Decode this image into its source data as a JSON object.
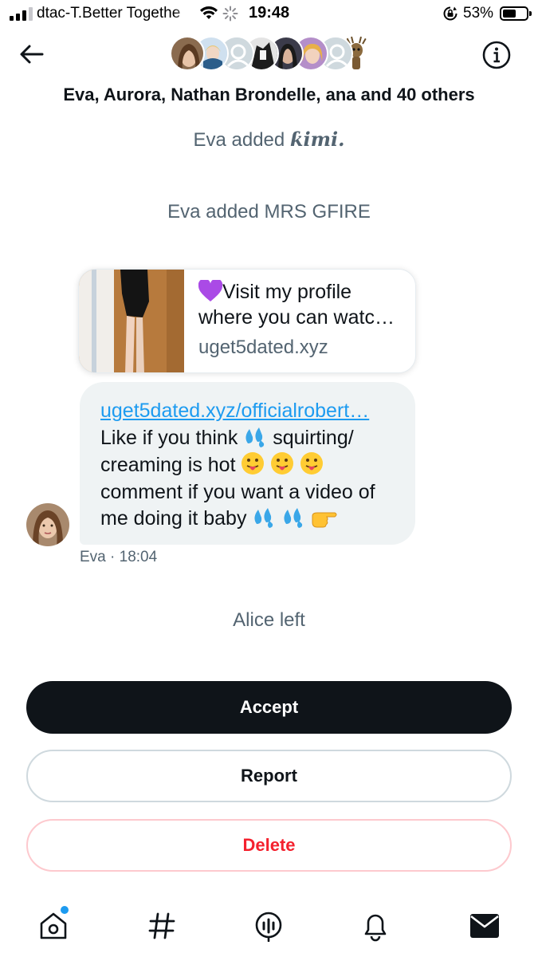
{
  "status_bar": {
    "carrier": "dtac-T.Better Togethe",
    "time": "19:48",
    "battery_percent": "53%",
    "battery_level": 0.53,
    "signal_bars": 3,
    "icons": [
      "signal-icon",
      "wifi-icon",
      "activity-spinner-icon",
      "rotation-lock-icon",
      "battery-icon"
    ]
  },
  "header": {
    "back_icon": "arrow-left-icon",
    "info_icon": "info-circle-icon",
    "group_names": "Eva, Aurora, Nathan Brondelle, ana and 40 others",
    "avatar_count": 8
  },
  "conversation": {
    "system_messages": [
      {
        "prefix": "Eva added ",
        "name": "ƙimi."
      },
      {
        "text": "Eva added MRS GFIRE"
      },
      {
        "text": "Alice left"
      }
    ],
    "link_card": {
      "title": "Visit my profile where you can watc…",
      "title_emoji": "purple-heart",
      "domain": "uget5dated.xyz"
    },
    "message": {
      "link": "uget5dated.xyz/officialrobert…",
      "line1": "Like if you think",
      "line1_end": "squirting/",
      "line2": "creaming is hot",
      "line3": "comment if you want a video of",
      "line4": "me doing it baby",
      "sender": "Eva",
      "timestamp": "· 18:04"
    }
  },
  "actions": {
    "accept": "Accept",
    "report": "Report",
    "delete": "Delete"
  },
  "bottom_nav": {
    "items": [
      "home-icon",
      "explore-hashtag-icon",
      "spaces-icon",
      "notifications-bell-icon",
      "messages-mail-icon"
    ],
    "active": "messages-mail-icon",
    "home_has_notification_dot": true
  },
  "colors": {
    "accent": "#1d9bf0",
    "text_primary": "#0f1419",
    "text_secondary": "#536471",
    "danger": "#f4212e",
    "bubble_bg": "#eff3f4"
  }
}
